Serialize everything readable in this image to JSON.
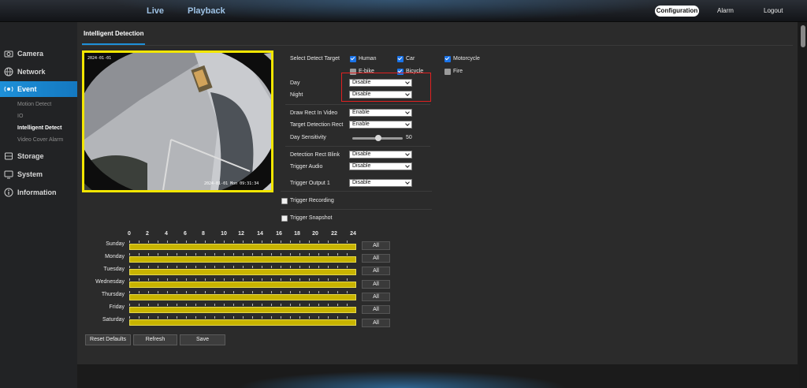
{
  "topnav": {
    "live": "Live",
    "playback": "Playback",
    "configuration": "Configuration",
    "alarm": "Alarm",
    "logout": "Logout"
  },
  "sidebar": {
    "items": [
      {
        "label": "Camera",
        "icon": "camera-icon"
      },
      {
        "label": "Network",
        "icon": "network-icon"
      },
      {
        "label": "Event",
        "icon": "event-icon"
      },
      {
        "label": "Storage",
        "icon": "storage-icon"
      },
      {
        "label": "System",
        "icon": "system-icon"
      },
      {
        "label": "Information",
        "icon": "information-icon"
      }
    ],
    "event_sub": [
      "Motion Detect",
      "IO",
      "Intelligent Detect",
      "Video Cover Alarm"
    ]
  },
  "page": {
    "title": "Intelligent Detection"
  },
  "video": {
    "timestamp_top": "2024-01-01",
    "timestamp_bottom": "2024-01-01 Mon 09:31:34"
  },
  "detect": {
    "label": "Select Detect Target",
    "targets": [
      {
        "label": "Human",
        "checked": true
      },
      {
        "label": "Car",
        "checked": true
      },
      {
        "label": "Motorcycle",
        "checked": true
      },
      {
        "label": "E-bike",
        "checked": false
      },
      {
        "label": "Bicycle",
        "checked": true
      },
      {
        "label": "Fire",
        "checked": false
      }
    ]
  },
  "settings": {
    "day_label": "Day",
    "day_value": "Disable",
    "night_label": "Night",
    "night_value": "Disable",
    "draw_rect_label": "Draw Rect In Video",
    "draw_rect_value": "Enable",
    "target_rect_label": "Target Detection Rect",
    "target_rect_value": "Enable",
    "sensitivity_label": "Day Sensitivity",
    "sensitivity_value": "50",
    "rect_blink_label": "Detection Rect Blink",
    "rect_blink_value": "Disable",
    "trigger_audio_label": "Trigger Audio",
    "trigger_audio_value": "Disable",
    "trigger_output_label": "Trigger Output 1",
    "trigger_output_value": "Disable",
    "trigger_recording_label": "Trigger Recording",
    "trigger_snapshot_label": "Trigger Snapshot"
  },
  "schedule": {
    "hours": [
      "0",
      "2",
      "4",
      "6",
      "8",
      "10",
      "12",
      "14",
      "16",
      "18",
      "20",
      "22",
      "24"
    ],
    "days": [
      "Sunday",
      "Monday",
      "Tuesday",
      "Wednesday",
      "Thursday",
      "Friday",
      "Saturday"
    ],
    "all_label": "All"
  },
  "buttons": {
    "reset": "Reset Defaults",
    "refresh": "Refresh",
    "save": "Save"
  },
  "colors": {
    "accent": "#1e90d8",
    "schedule_bar": "#c8b400",
    "highlight_box": "#e02020",
    "video_border": "#f2e600"
  }
}
